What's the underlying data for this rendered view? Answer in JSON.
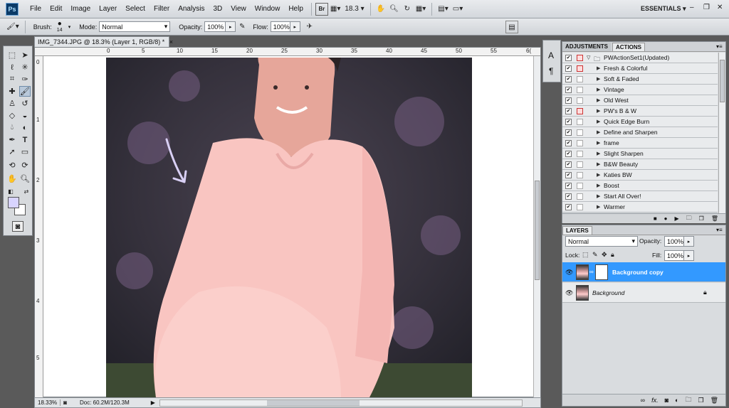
{
  "menubar": {
    "logo": "Ps",
    "items": [
      "File",
      "Edit",
      "Image",
      "Layer",
      "Select",
      "Filter",
      "Analysis",
      "3D",
      "View",
      "Window",
      "Help"
    ],
    "bridge_label": "Br",
    "zoom_value": "18.3",
    "workspace": "ESSENTIALS",
    "icons": {
      "hand": "hand-icon",
      "zoom": "magnifier-icon",
      "rotate": "rotate-view-icon",
      "arrange": "arrange-documents-icon",
      "screen_mode": "screen-mode-icon"
    }
  },
  "options": {
    "brush_label": "Brush:",
    "brush_size": "14",
    "mode_label": "Mode:",
    "mode_value": "Normal",
    "opacity_label": "Opacity:",
    "opacity_value": "100%",
    "flow_label": "Flow:",
    "flow_value": "100%"
  },
  "document": {
    "tab_title": "IMG_7344.JPG @ 18.3% (Layer 1, RGB/8) *",
    "ruler_top": [
      "0",
      "5",
      "10",
      "15",
      "20",
      "25",
      "30",
      "35",
      "40",
      "45",
      "50",
      "55",
      "6("
    ],
    "ruler_left": [
      "0",
      "1",
      "2",
      "3",
      "4",
      "5"
    ],
    "status_zoom": "18.33%",
    "status_doc": "Doc: 60.2M/120.3M"
  },
  "panels": {
    "actions": {
      "tab_adjustments": "ADJUSTMENTS",
      "tab_actions": "ACTIONS",
      "set_name": "PWActionSet1(Updated)",
      "items": [
        {
          "label": "Fresh & Colorful",
          "dialog": true
        },
        {
          "label": "Soft & Faded",
          "dialog": false
        },
        {
          "label": "Vintage",
          "dialog": false
        },
        {
          "label": "Old West",
          "dialog": false
        },
        {
          "label": "PW's B & W",
          "dialog": true
        },
        {
          "label": "Quick Edge Burn",
          "dialog": false
        },
        {
          "label": "Define and Sharpen",
          "dialog": false
        },
        {
          "label": "frame",
          "dialog": false
        },
        {
          "label": "Slight Sharpen",
          "dialog": false
        },
        {
          "label": "B&W Beauty",
          "dialog": false
        },
        {
          "label": "Katies BW",
          "dialog": false
        },
        {
          "label": "Boost",
          "dialog": false
        },
        {
          "label": "Start All Over!",
          "dialog": false
        },
        {
          "label": "Warmer",
          "dialog": false
        }
      ]
    },
    "layers": {
      "tab": "LAYERS",
      "blend_mode": "Normal",
      "opacity_label": "Opacity:",
      "opacity_value": "100%",
      "lock_label": "Lock:",
      "fill_label": "Fill:",
      "fill_value": "100%",
      "items": [
        {
          "name": "Background copy",
          "selected": true
        },
        {
          "name": "Background",
          "selected": false
        }
      ]
    }
  },
  "colors": {
    "selection": "#3399ff",
    "foreground": "#d8d4ff",
    "background": "#ffffff"
  }
}
